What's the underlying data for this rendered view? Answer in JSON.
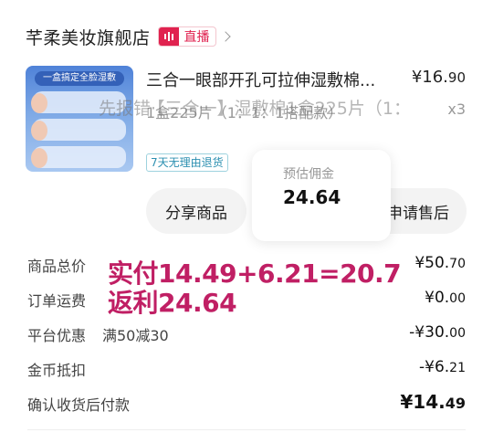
{
  "store": {
    "name": "芊柔美妆旗舰店",
    "live_label": "直播",
    "chevron_icon": "chevron-right-icon"
  },
  "product": {
    "thumbnail_banner": "一盒搞定全脸湿敷",
    "title": "三合一眼部开孔可拉伸湿敷棉...",
    "price_main": "¥16.",
    "price_cents": "90",
    "spec": "1盒225片（1：1：1搭配款）",
    "spec_overlay": "先报错·【三合一】湿敷棉1盒225片（1：",
    "quantity": "x3",
    "tag": "7天无理由退货"
  },
  "actions": {
    "share": "分享商品",
    "after_sale": "申请售后"
  },
  "commission_popup": {
    "label": "预估佣金",
    "value": "24.64"
  },
  "summary": {
    "rows": [
      {
        "label": "商品总价",
        "main": "¥50.",
        "cents": "70"
      },
      {
        "label": "订单运费",
        "main": "¥0.",
        "cents": "00"
      },
      {
        "label": "平台优惠",
        "tag": "满50减30",
        "main": "-¥30.",
        "cents": "00"
      },
      {
        "label": "金币抵扣",
        "main": "-¥6.",
        "cents": "21"
      },
      {
        "label": "确认收货后付款",
        "main": "¥14.",
        "cents": "49"
      }
    ]
  },
  "annotation": {
    "line1": "实付14.49+6.21=20.7",
    "line2": "返利24.64",
    "color": "#c01f64"
  },
  "colors": {
    "accent": "#e0224f",
    "tag_blue": "#2b8fb0"
  }
}
